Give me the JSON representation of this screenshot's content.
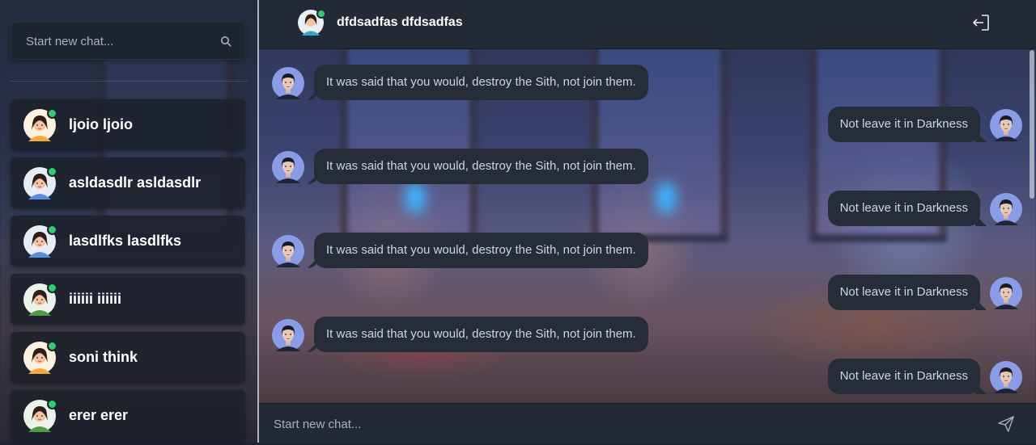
{
  "sidebar": {
    "search_placeholder": "Start new chat...",
    "contacts": [
      {
        "name": "ljoio ljoio",
        "online": true,
        "avatar": "woman-avatar-orange"
      },
      {
        "name": "asldasdlr asldasdlr",
        "online": true,
        "avatar": "woman-avatar-blue"
      },
      {
        "name": "lasdlfks lasdlfks",
        "online": true,
        "avatar": "woman-avatar-blue"
      },
      {
        "name": "iiiiii iiiiii",
        "online": true,
        "avatar": "woman-avatar-green"
      },
      {
        "name": "soni think",
        "online": true,
        "avatar": "woman-avatar-orange"
      },
      {
        "name": "erer erer",
        "online": true,
        "avatar": "woman-avatar-green"
      }
    ]
  },
  "chat": {
    "header": {
      "name": "dfdsadfas dfdsadfas",
      "online": true
    },
    "messages": [
      {
        "direction": "in",
        "text": "It was said that you would, destroy the Sith, not join them."
      },
      {
        "direction": "out",
        "text": "Not leave it in Darkness"
      },
      {
        "direction": "in",
        "text": "It was said that you would, destroy the Sith, not join them."
      },
      {
        "direction": "out",
        "text": "Not leave it in Darkness"
      },
      {
        "direction": "in",
        "text": "It was said that you would, destroy the Sith, not join them."
      },
      {
        "direction": "out",
        "text": "Not leave it in Darkness"
      },
      {
        "direction": "in",
        "text": "It was said that you would, destroy the Sith, not join them."
      },
      {
        "direction": "out",
        "text": "Not leave it in Darkness"
      }
    ],
    "composer_placeholder": "Start new chat..."
  },
  "icons": {
    "search": "search-icon",
    "logout": "logout-icon",
    "send": "send-icon"
  },
  "colors": {
    "online": "#2ecc71",
    "panel": "#232a35",
    "bubble": "#262d38"
  }
}
